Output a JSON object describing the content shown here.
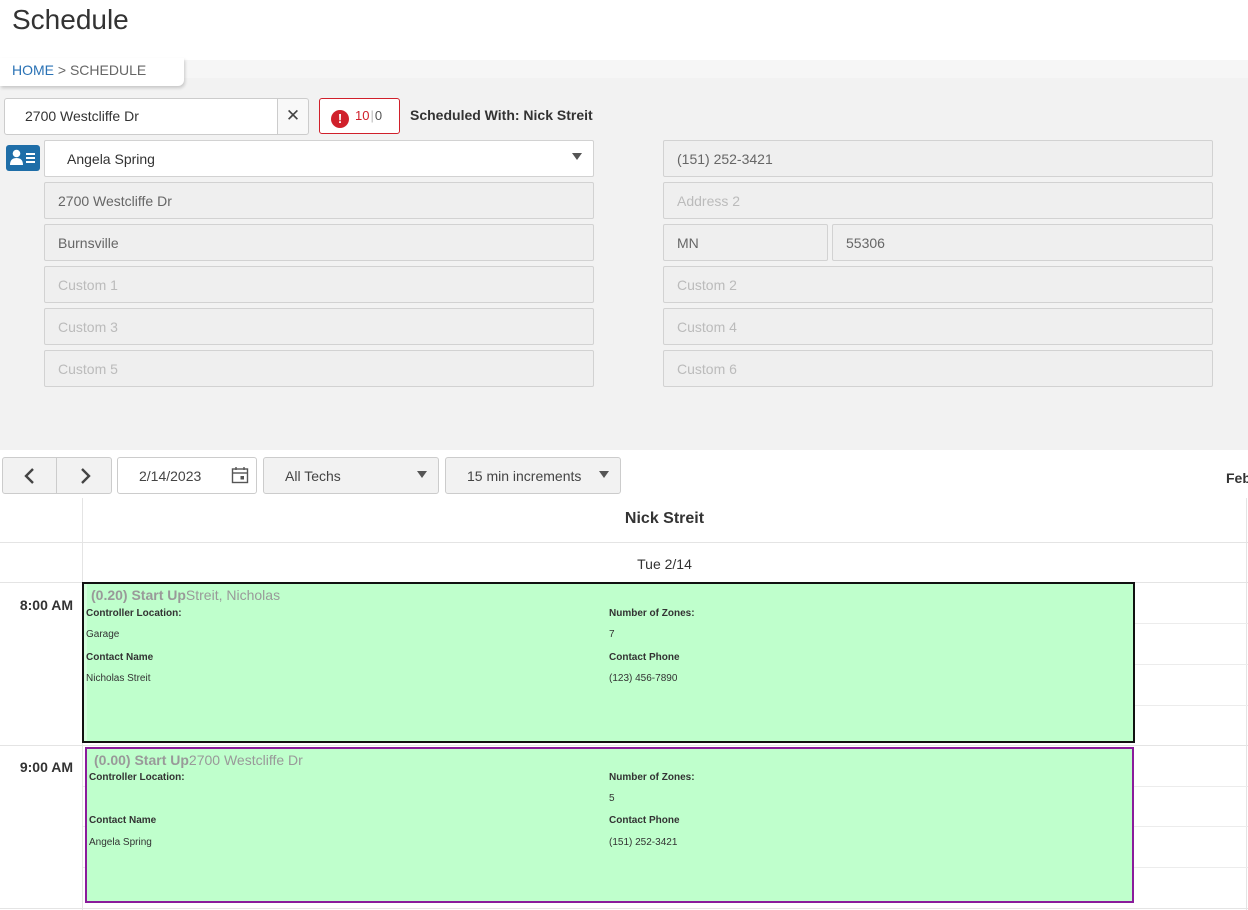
{
  "page": {
    "title": "Schedule"
  },
  "breadcrumb": {
    "home": "HOME",
    "separator": ">",
    "current": "SCHEDULE"
  },
  "search": {
    "address_value": "2700 Westcliffe Dr"
  },
  "alert": {
    "count_primary": "10",
    "divider": "|",
    "count_secondary": "0",
    "icon": "exclamation-icon",
    "color": "#d0202b"
  },
  "scheduled_with": "Scheduled With: Nick Streit",
  "customer": {
    "name": "Angela Spring",
    "phone": "(151) 252-3421",
    "address1": "2700 Westcliffe Dr",
    "address2_placeholder": "Address 2",
    "city": "Burnsville",
    "state": "MN",
    "zip": "55306",
    "custom1_placeholder": "Custom 1",
    "custom2_placeholder": "Custom 2",
    "custom3_placeholder": "Custom 3",
    "custom4_placeholder": "Custom 4",
    "custom5_placeholder": "Custom 5",
    "custom6_placeholder": "Custom 6"
  },
  "toolbar": {
    "date": "2/14/2023",
    "techs": "All Techs",
    "increment": "15 min increments",
    "month_label": "Feb"
  },
  "calendar": {
    "tech_name": "Nick Streit",
    "day_header": "Tue 2/14",
    "times": [
      "8:00 AM",
      "9:00 AM"
    ],
    "appointments": [
      {
        "priority": "(0.20) Start Up",
        "subtitle": "Streit, Nicholas",
        "controller_label": "Controller Location:",
        "controller_value": "Garage",
        "zones_label": "Number of Zones:",
        "zones_value": "7",
        "contact_name_label": "Contact Name",
        "contact_name_value": "Nicholas Streit",
        "contact_phone_label": "Contact Phone",
        "contact_phone_value": "(123) 456-7890"
      },
      {
        "priority": "(0.00) Start Up",
        "subtitle": "2700 Westcliffe Dr",
        "controller_label": "Controller Location:",
        "controller_value": "",
        "zones_label": "Number of Zones:",
        "zones_value": "5",
        "contact_name_label": "Contact Name",
        "contact_name_value": "Angela Spring",
        "contact_phone_label": "Contact Phone",
        "contact_phone_value": "(151) 252-3421"
      }
    ]
  },
  "colors": {
    "accent": "#1f6ea8",
    "appt_bg": "#bfffcc",
    "selected_border": "#111111",
    "appt2_border": "#8a1c9b"
  }
}
